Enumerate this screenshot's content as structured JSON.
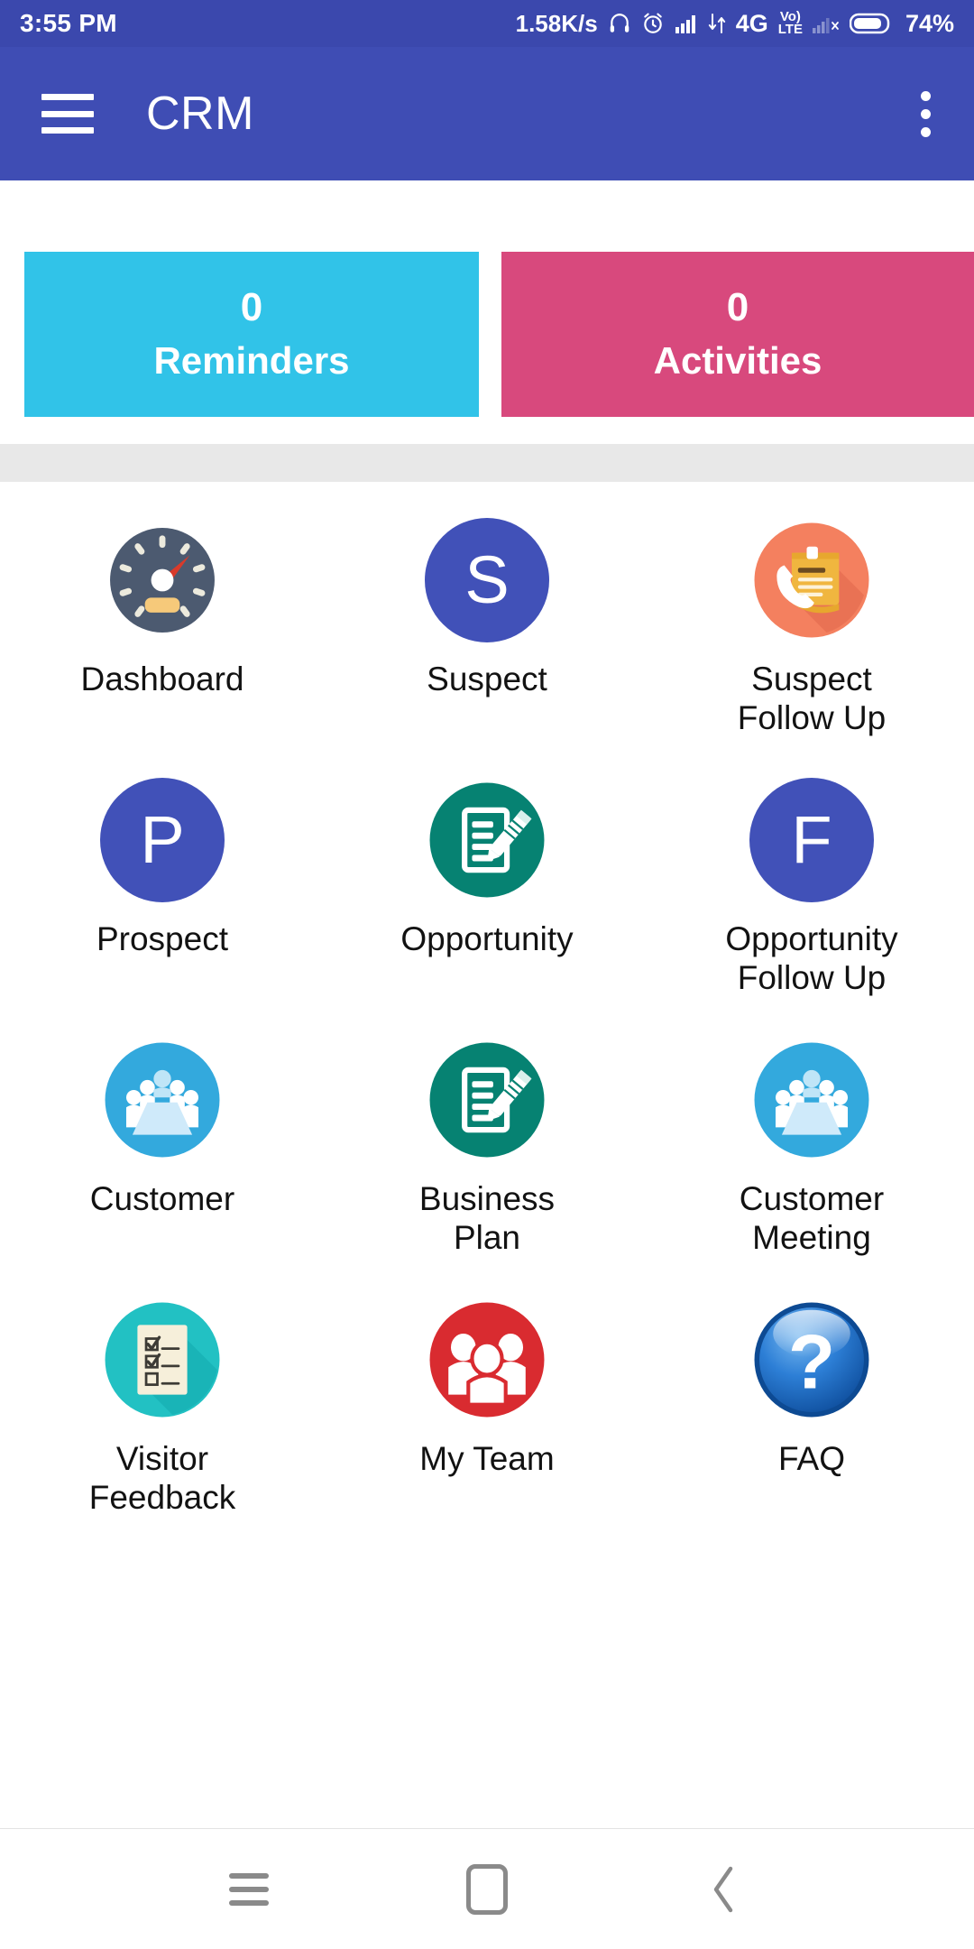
{
  "statusbar": {
    "time": "3:55 PM",
    "network_speed": "1.58K/s",
    "battery_percent": "74%",
    "icons": [
      "headphone-icon",
      "alarm-clock-icon",
      "signal-bars-icon",
      "data-transfer-icon",
      "4g-icon",
      "volte-icon",
      "signal-bars-off-icon",
      "battery-icon"
    ],
    "network_type": "4G",
    "volte_top": "Vo)",
    "volte_bottom": "LTE",
    "background": "#3b48ad"
  },
  "appbar": {
    "title": "CRM",
    "menu_icon": "hamburger-menu-icon",
    "overflow_icon": "more-vertical-icon",
    "background": "#3f4db4"
  },
  "stats": [
    {
      "count": "0",
      "label": "Reminders",
      "color": "#31c3e8",
      "name": "reminders-card"
    },
    {
      "count": "0",
      "label": "Activities",
      "color": "#d8497d",
      "name": "activities-card"
    }
  ],
  "grid": [
    {
      "label": "Dashboard",
      "icon": "speedometer-icon",
      "color": "#4c5a70"
    },
    {
      "label": "Suspect",
      "icon": "letter-s-icon",
      "color": "#4151b8",
      "letter": "S"
    },
    {
      "label": "Suspect\nFollow Up",
      "icon": "phone-notepad-icon",
      "color": "#f27a5e"
    },
    {
      "label": "Prospect",
      "icon": "letter-p-icon",
      "color": "#4151b8",
      "letter": "P"
    },
    {
      "label": "Opportunity",
      "icon": "document-pencil-icon",
      "color": "#068272"
    },
    {
      "label": "Opportunity\nFollow Up",
      "icon": "letter-f-icon",
      "color": "#4151b8",
      "letter": "F"
    },
    {
      "label": "Customer",
      "icon": "meeting-people-icon",
      "color": "#33a9dd"
    },
    {
      "label": "Business\nPlan",
      "icon": "document-pencil-icon",
      "color": "#068272"
    },
    {
      "label": "Customer\nMeeting",
      "icon": "meeting-people-icon",
      "color": "#33a9dd"
    },
    {
      "label": "Visitor\nFeedback",
      "icon": "checklist-icon",
      "color": "#22c1c3"
    },
    {
      "label": "My Team",
      "icon": "people-group-icon",
      "color": "#d92b30"
    },
    {
      "label": "FAQ",
      "icon": "question-mark-icon",
      "color": "#1f6fd0"
    }
  ],
  "navbar": {
    "recents_icon": "recents-icon",
    "home_icon": "home-icon",
    "back_icon": "back-chevron-icon"
  }
}
